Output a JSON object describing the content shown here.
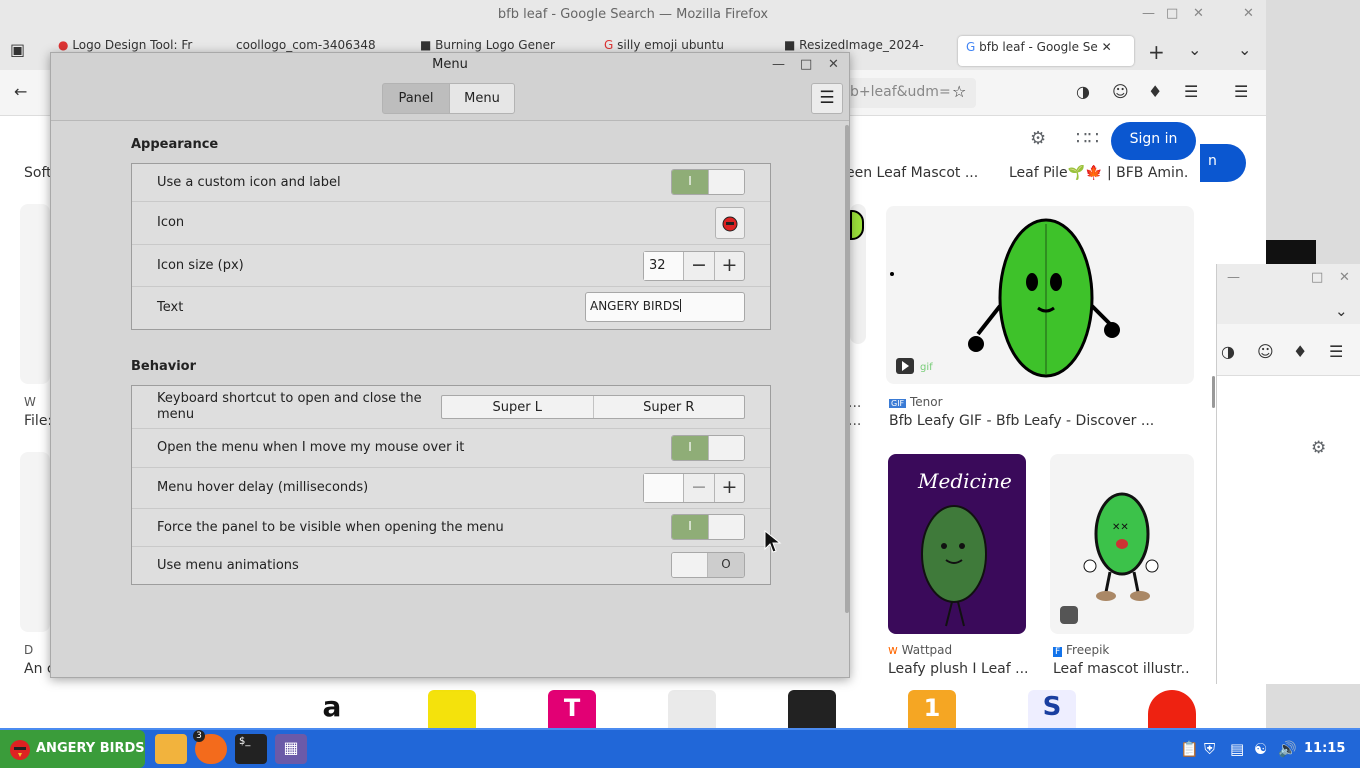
{
  "browser": {
    "window_title": "bfb leaf - Google Search — Mozilla Firefox",
    "tabs": [
      {
        "label": "Logo Design Tool: Fr"
      },
      {
        "label": "coollogo_com-3406348"
      },
      {
        "label": "Burning Logo Gener"
      },
      {
        "label": "silly emoji ubuntu"
      },
      {
        "label": "ResizedImage_2024-"
      },
      {
        "label": "bfb leaf - Google Se"
      }
    ],
    "url_fragment": "b+leaf&udm=",
    "signin_label": "Sign in",
    "signin_ghost": "n",
    "results": {
      "caption_top_1": "een Leaf Mascot ...",
      "caption_top_2": "Leaf Pile🌱🍁 | BFB Amin...",
      "left_caption_1": "Soft",
      "left_caption_2": "File:",
      "left_caption_3": "An c",
      "left_src_1": "W",
      "left_src_3": "D",
      "tenor_src": "Tenor",
      "tenor_caption": "Bfb Leafy GIF - Bfb Leafy - Discover ...",
      "wattpad_src": "Wattpad",
      "wattpad_caption": "Leafy plush I Leaf ...",
      "freepik_src": "Freepik",
      "freepik_caption": "Leaf mascot illustr...",
      "medicine_text": "Medicine",
      "gif_mark": "gif",
      "ellipsis": "..."
    }
  },
  "dialog": {
    "title": "Menu",
    "tabs": [
      "Panel",
      "Menu"
    ],
    "appearance": {
      "title": "Appearance",
      "custom_icon_label": "Use a custom icon and label",
      "icon_label": "Icon",
      "icon_size_label": "Icon size (px)",
      "icon_size_value": "32",
      "text_label": "Text",
      "text_value": "ANGERY BIRDS"
    },
    "behavior": {
      "title": "Behavior",
      "shortcut_label": "Keyboard shortcut to open and close the menu",
      "shortcut_1": "Super L",
      "shortcut_2": "Super R",
      "hover_open_label": "Open the menu when I move my mouse over it",
      "hover_delay_label": "Menu hover delay (milliseconds)",
      "hover_delay_value": "",
      "force_panel_label": "Force the panel to be visible when opening the menu",
      "animations_label": "Use menu animations"
    },
    "switches": {
      "custom_icon": true,
      "hover_open": true,
      "force_panel": true,
      "animations": false
    },
    "switch_on_mark": "I",
    "switch_off_mark": "O",
    "minus": "−",
    "plus": "+"
  },
  "taskbar": {
    "start_label": "ANGERY BIRDS",
    "badge": "3",
    "terminal_glyph": "$_",
    "clock": "11:15"
  },
  "colors": {
    "taskbar": "#2167d8",
    "start": "#3a9c3a",
    "switch_on": "#8fad77",
    "google_blue": "#0b57d0"
  }
}
